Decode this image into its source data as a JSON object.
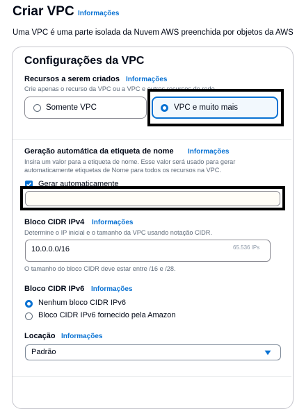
{
  "header": {
    "title": "Criar VPC",
    "info": "Informações",
    "description": "Uma VPC é uma parte isolada da Nuvem AWS preenchida por objetos da AWS"
  },
  "vpc_settings": {
    "title": "Configurações da VPC",
    "resources": {
      "label": "Recursos a serem criados",
      "info": "Informações",
      "description": "Crie apenas o recurso da VPC ou a VPC e outros recursos de rede.",
      "options": [
        {
          "label": "Somente VPC",
          "selected": false
        },
        {
          "label": "VPC e muito mais",
          "selected": true
        }
      ]
    },
    "name_tag": {
      "label": "Geração automática da etiqueta de nome",
      "info": "Informações",
      "description_line1": "Insira um valor para a etiqueta de nome. Esse valor será usado para gerar",
      "description_line2": "automaticamente etiquetas de Nome para todos os recursos na VPC.",
      "checkbox_label": "Gerar automaticamente",
      "checkbox_checked": true,
      "value": ""
    },
    "ipv4_cidr": {
      "label": "Bloco CIDR IPv4",
      "info": "Informações",
      "description": "Determine o IP inicial e o tamanho da VPC usando notação CIDR.",
      "value": "10.0.0.0/16",
      "suffix": "65.536 IPs",
      "constraint": "O tamanho do bloco CIDR deve estar entre /16 e /28."
    },
    "ipv6_cidr": {
      "label": "Bloco CIDR IPv6",
      "info": "Informações",
      "options": [
        {
          "label": "Nenhum bloco CIDR IPv6",
          "selected": true
        },
        {
          "label": "Bloco CIDR IPv6 fornecido pela Amazon",
          "selected": false
        }
      ]
    },
    "tenancy": {
      "label": "Locação",
      "info": "Informações",
      "value": "Padrão"
    }
  },
  "colors": {
    "accent": "#0972d3",
    "text": "#000716",
    "muted": "#5f6b7a"
  }
}
